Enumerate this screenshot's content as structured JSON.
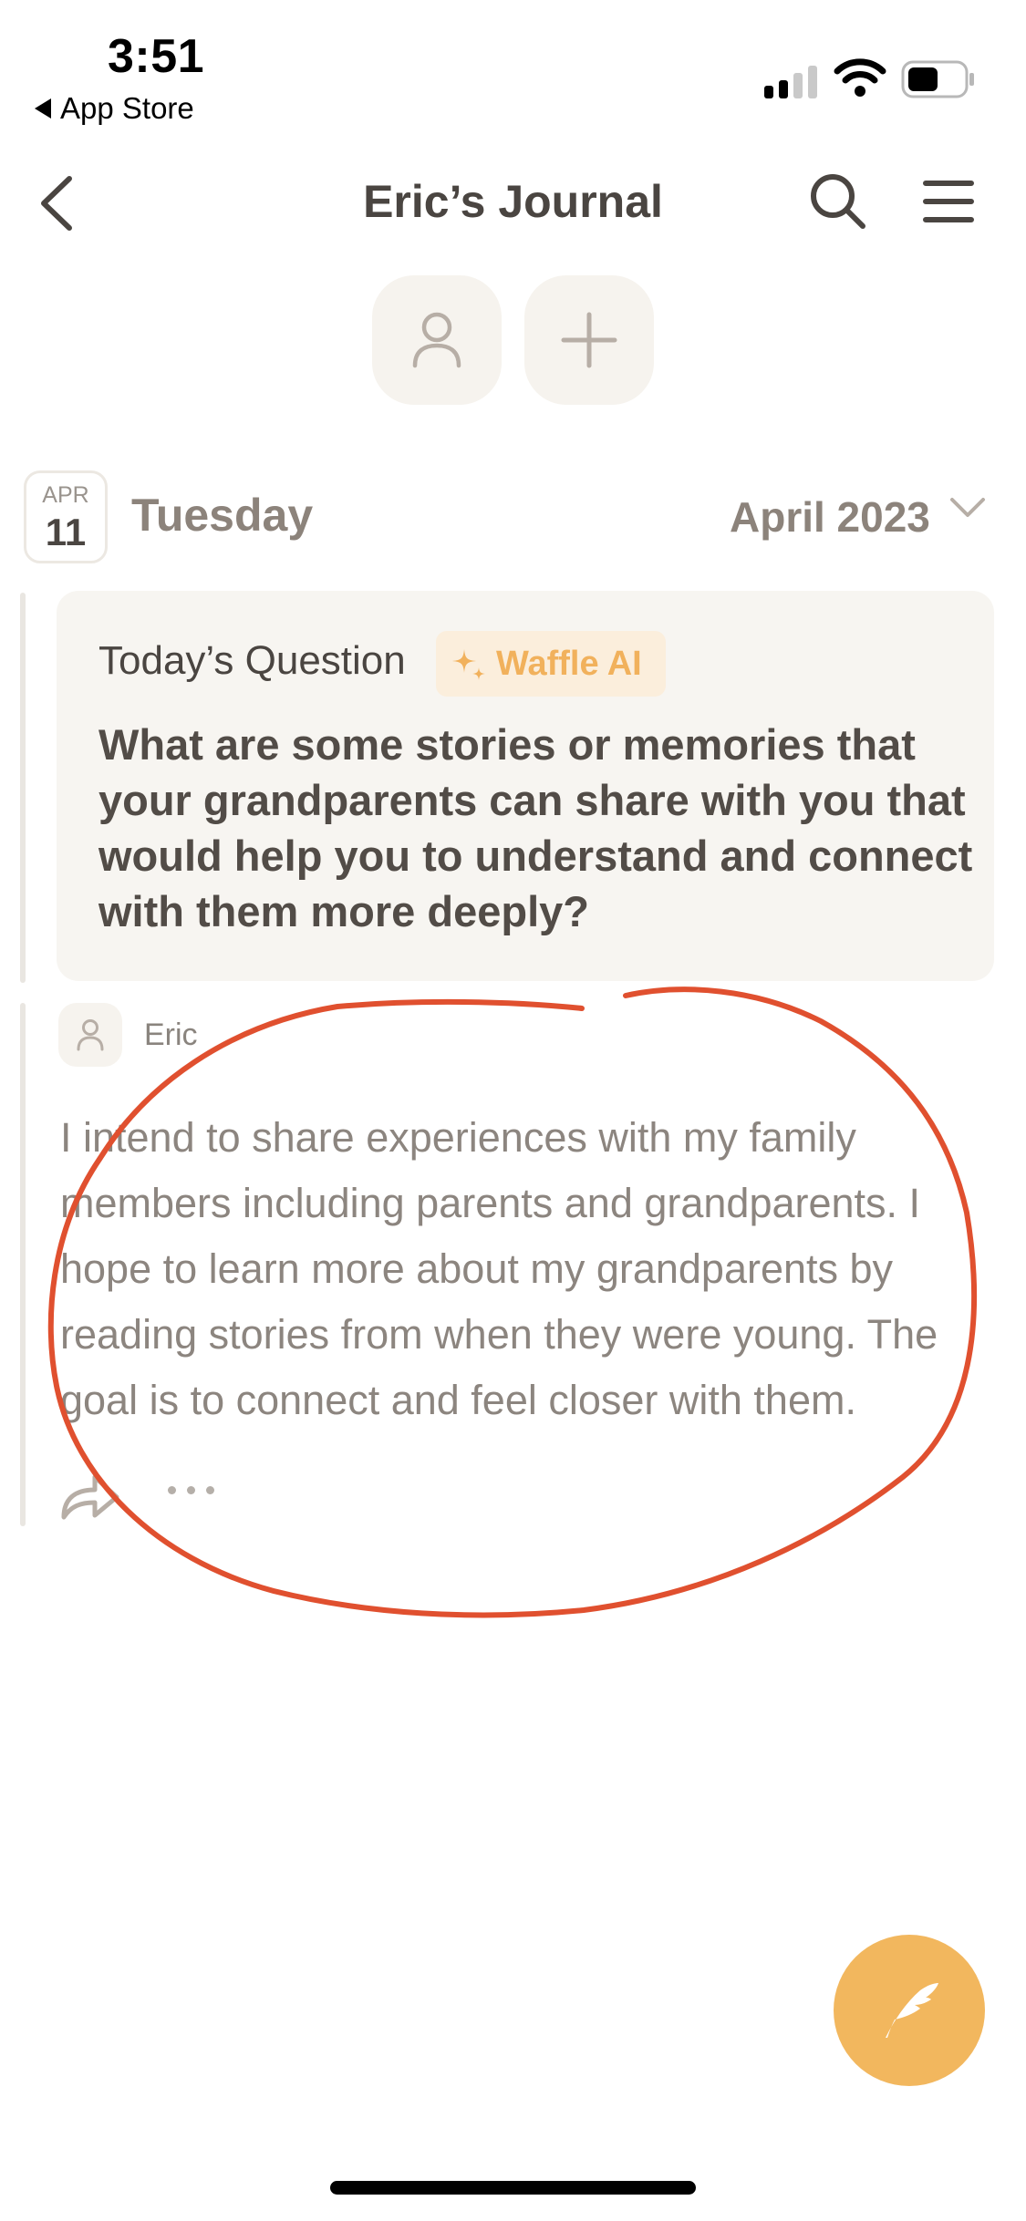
{
  "status_bar": {
    "time": "3:51",
    "back_app": "App Store"
  },
  "nav": {
    "title": "Eric’s Journal",
    "back_icon": "chevron-left-icon",
    "search_icon": "search-icon",
    "menu_icon": "hamburger-menu-icon"
  },
  "actions": {
    "person_icon": "person-icon",
    "add_icon": "plus-icon"
  },
  "date": {
    "month_abbr": "APR",
    "day": "11",
    "weekday": "Tuesday",
    "month_selector": "April 2023"
  },
  "question": {
    "label": "Today’s Question",
    "badge": "Waffle AI",
    "text": "What are some stories or memories that your grandparents can share with you that would help you to understand and connect with them more deeply?"
  },
  "entry": {
    "author": "Eric",
    "text": "I intend to share experiences with my family members including parents and grandparents. I hope to learn more about my grandparents by reading stories from when they were young. The goal is to connect and feel closer with them."
  },
  "colors": {
    "accent": "#f2b75e",
    "annotation": "#e0502f",
    "card_bg": "#f7f5f1"
  }
}
